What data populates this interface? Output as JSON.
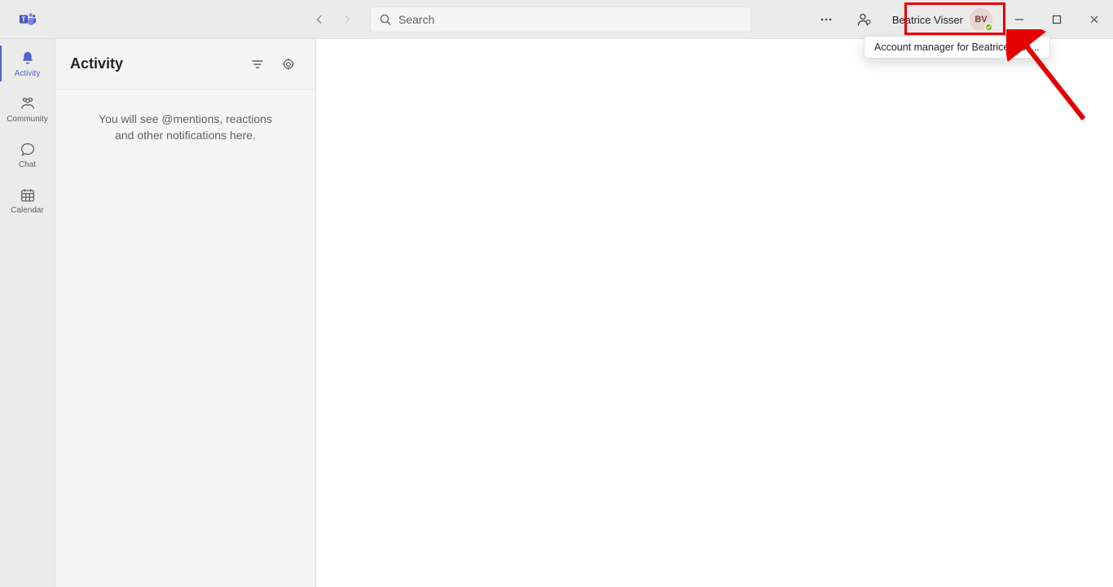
{
  "titlebar": {
    "search_placeholder": "Search",
    "account_name": "Beatrice Visser",
    "account_initials": "BV",
    "tooltip": "Account manager for Beatrice Viss..."
  },
  "rail": {
    "items": [
      {
        "id": "activity",
        "label": "Activity",
        "active": true
      },
      {
        "id": "community",
        "label": "Community",
        "active": false
      },
      {
        "id": "chat",
        "label": "Chat",
        "active": false
      },
      {
        "id": "calendar",
        "label": "Calendar",
        "active": false
      }
    ]
  },
  "panel": {
    "title": "Activity",
    "empty_msg_line1": "You will see @mentions, reactions",
    "empty_msg_line2": "and other notifications here."
  }
}
